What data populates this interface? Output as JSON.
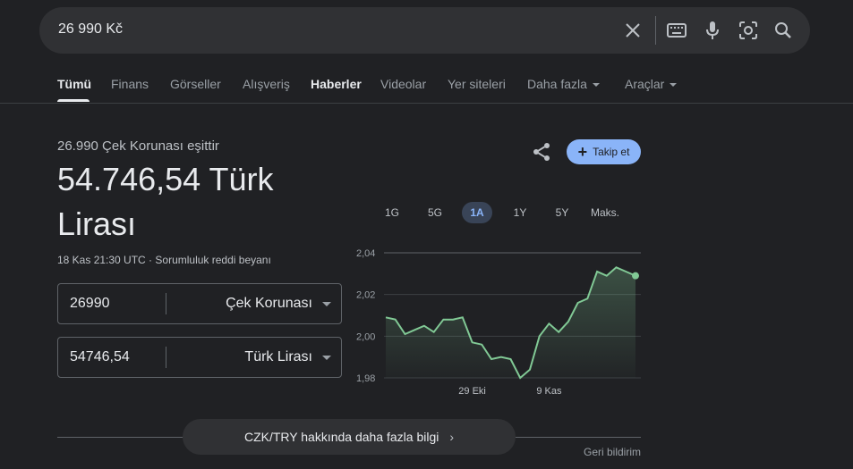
{
  "search": {
    "query": "26 990 Kč"
  },
  "tabs": [
    {
      "label": "Tümü"
    },
    {
      "label": "Finans"
    },
    {
      "label": "Görseller"
    },
    {
      "label": "Alışveriş"
    },
    {
      "label": "Haberler"
    },
    {
      "label": "Videolar"
    },
    {
      "label": "Yer siteleri"
    },
    {
      "label": "Daha fazla"
    },
    {
      "label": "Araçlar"
    }
  ],
  "converter": {
    "equals_text": "26.990 Çek Korunası eşittir",
    "result_text": "54.746,54 Türk Lirası",
    "updated_text": "18 Kas 21:30 UTC",
    "separator": " · ",
    "disclaimer": "Sorumluluk reddi beyanı",
    "from": {
      "amount": "26990",
      "currency": "Çek Korunası"
    },
    "to": {
      "amount": "54746,54",
      "currency": "Türk Lirası"
    }
  },
  "follow_label": "Takip et",
  "ranges": [
    "1G",
    "5G",
    "1A",
    "1Y",
    "5Y",
    "Maks."
  ],
  "active_range": "1A",
  "more_info_label": "CZK/TRY hakkında daha fazla bilgi",
  "feedback_label": "Geri bildirim",
  "colors": {
    "accent": "#8ab4f8",
    "line": "#81c995",
    "background": "#202124"
  },
  "chart_data": {
    "type": "line",
    "series": [
      {
        "values": [
          2.009,
          2.008,
          2.001,
          2.003,
          2.005,
          2.002,
          2.008,
          2.008,
          2.009,
          1.997,
          1.996,
          1.989,
          1.99,
          1.989,
          1.98,
          1.984,
          2.0,
          2.006,
          2.002,
          2.007,
          2.016,
          2.018,
          2.031,
          2.029,
          2.033,
          2.031,
          2.029
        ]
      }
    ],
    "x_tick_labels": [
      {
        "index": 9,
        "label": "29 Eki"
      },
      {
        "index": 17,
        "label": "9 Kas"
      }
    ],
    "y_ticks": [
      1.98,
      2.0,
      2.02,
      2.04
    ],
    "y_tick_labels": [
      "1,98",
      "2,00",
      "2,02",
      "2,04"
    ],
    "ylim": [
      1.98,
      2.04
    ],
    "grid": "horizontal"
  }
}
